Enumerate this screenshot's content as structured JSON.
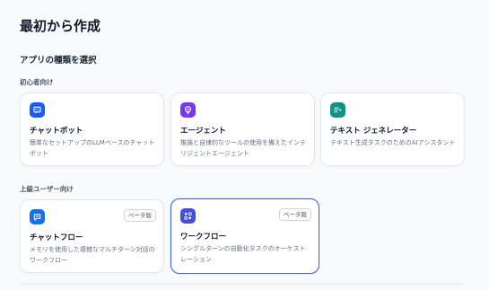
{
  "page": {
    "title": "最初から作成"
  },
  "section": {
    "title": "アプリの種類を選択"
  },
  "groups": {
    "beginner": "初心者向け",
    "advanced": "上級ユーザー向け"
  },
  "cards": [
    {
      "title": "チャットボット",
      "description": "簡単なセットアップのLLMベースのチャットボット",
      "icon": "chatbot-icon",
      "color": "#155eef"
    },
    {
      "title": "エージェント",
      "description": "推論と自律的なツールの使用を備えたインテリジェントエージェント",
      "icon": "agent-icon",
      "color": "#7839ee"
    },
    {
      "title": "テキスト ジェネレーター",
      "description": "テキスト生成タスクのためのAIアシスタント",
      "icon": "text-generator-icon",
      "color": "#0e9384"
    },
    {
      "title": "チャットフロー",
      "description": "メモリを使用した複雑なマルチターン対話のワークフロー",
      "icon": "chatflow-icon",
      "color": "#1570ef",
      "badge": "ベータ版"
    },
    {
      "title": "ワークフロー",
      "description": "シングルターンの自動化タスクのオーケストレーション",
      "icon": "workflow-icon",
      "color": "#444ce7",
      "badge": "ベータ版",
      "selected": true
    }
  ]
}
